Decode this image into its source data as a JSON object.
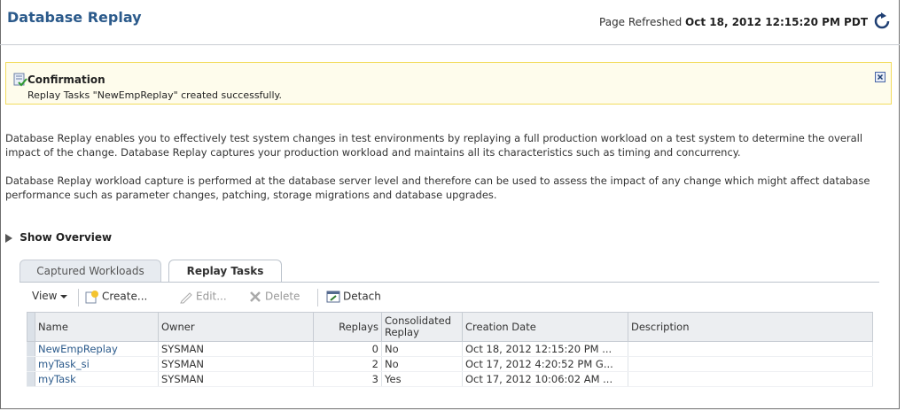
{
  "header": {
    "title": "Database Replay",
    "refreshed_label": "Page Refreshed",
    "refreshed_time": "Oct 18, 2012 12:15:20 PM PDT"
  },
  "confirmation": {
    "title": "Confirmation",
    "message": "Replay Tasks \"NewEmpReplay\" created successfully."
  },
  "description": {
    "para1": "Database Replay enables you to effectively test system changes in test environments by replaying a full production workload on a test system to determine the overall impact of the change. Database Replay captures your production workload and maintains all its characteristics such as timing and concurrency.",
    "para2": "Database Replay workload capture is performed at the database server level and therefore can be used to assess the impact of any change which might affect database performance such as parameter changes, patching, storage migrations and database upgrades."
  },
  "show_overview": "Show Overview",
  "tabs": [
    {
      "label": "Captured Workloads",
      "active": false
    },
    {
      "label": "Replay Tasks",
      "active": true
    }
  ],
  "toolbar": {
    "view": "View",
    "create": "Create...",
    "edit": "Edit...",
    "delete": "Delete",
    "detach": "Detach"
  },
  "table": {
    "columns": [
      "Name",
      "Owner",
      "Replays",
      "Consolidated Replay",
      "Creation Date",
      "Description"
    ],
    "rows": [
      {
        "name": "NewEmpReplay",
        "owner": "SYSMAN",
        "replays": "0",
        "consolidated": "No",
        "created": "Oct 18, 2012 12:15:20 PM ...",
        "description": ""
      },
      {
        "name": "myTask_si",
        "owner": "SYSMAN",
        "replays": "2",
        "consolidated": "No",
        "created": "Oct 17, 2012 4:20:52 PM G...",
        "description": ""
      },
      {
        "name": "myTask",
        "owner": "SYSMAN",
        "replays": "3",
        "consolidated": "Yes",
        "created": "Oct 17, 2012 10:06:02 AM ...",
        "description": ""
      }
    ]
  },
  "colors": {
    "title": "#2b5a8b",
    "link": "#2b5a8b",
    "confirm_border": "#f2dc5e",
    "confirm_bg": "#fefcec"
  }
}
